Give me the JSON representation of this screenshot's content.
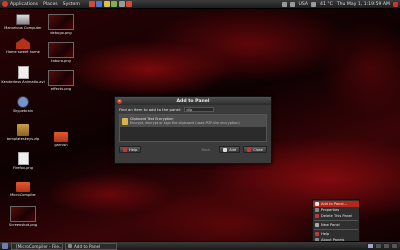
{
  "top_panel": {
    "menus": [
      "Applications",
      "Places",
      "System"
    ],
    "launcher_colors": [
      "#d84a2e",
      "#4a78c9",
      "#e0c23a",
      "#7fb04c",
      "#999999",
      "#d84a2e"
    ],
    "tray": {
      "locale": "USA",
      "temperature": "41 °C",
      "datetime": "Thu May 1, 1:19:59 AM"
    }
  },
  "desktop_icons": [
    {
      "label": "Marvelous Computer",
      "icon": "computer-icon"
    },
    {
      "label": "Home sweet home",
      "icon": "home-folder-icon"
    },
    {
      "label": "Kenderless Animatio.avi",
      "icon": "video-file-icon"
    },
    {
      "label": "Skypebrain",
      "icon": "skype-icon"
    },
    {
      "label": "templateskeys.zip",
      "icon": "archive-icon"
    },
    {
      "label": "Firefox.png",
      "icon": "image-file-icon"
    },
    {
      "label": "MicroCompiler",
      "icon": "folder-icon"
    },
    {
      "label": "Screenshot.png",
      "icon": "screenshot-thumbnail"
    },
    {
      "label": "debugo.png",
      "icon": "screenshot-thumbnail"
    },
    {
      "label": "taburo.png",
      "icon": "screenshot-thumbnail"
    },
    {
      "label": "effects.png",
      "icon": "screenshot-thumbnail"
    },
    {
      "label": "garnish",
      "icon": "folder-icon"
    }
  ],
  "dialog": {
    "title": "Add to Panel",
    "find_label": "Find an item to add to the panel:",
    "find_value": "clip",
    "items": [
      {
        "name": "Clipboard Text Encryption",
        "description": "Encrypt, decrypt or sign the clipboard (uses PGP-like encryption)"
      }
    ],
    "buttons": {
      "help": "Help",
      "back": "Back",
      "add": "Add",
      "close": "Close"
    }
  },
  "context_menu": {
    "items": [
      {
        "label": "Add to Panel...",
        "selected": true
      },
      {
        "label": "Properties",
        "selected": false
      },
      {
        "label": "Delete This Panel",
        "selected": false
      },
      {
        "label": "New Panel",
        "selected": false
      },
      {
        "label": "Help",
        "selected": false
      },
      {
        "label": "About Panels",
        "selected": false
      }
    ]
  },
  "bottom_panel": {
    "tasks": [
      "[MicroCompiler - File...",
      "Add to Panel"
    ],
    "workspace_count": 4
  }
}
